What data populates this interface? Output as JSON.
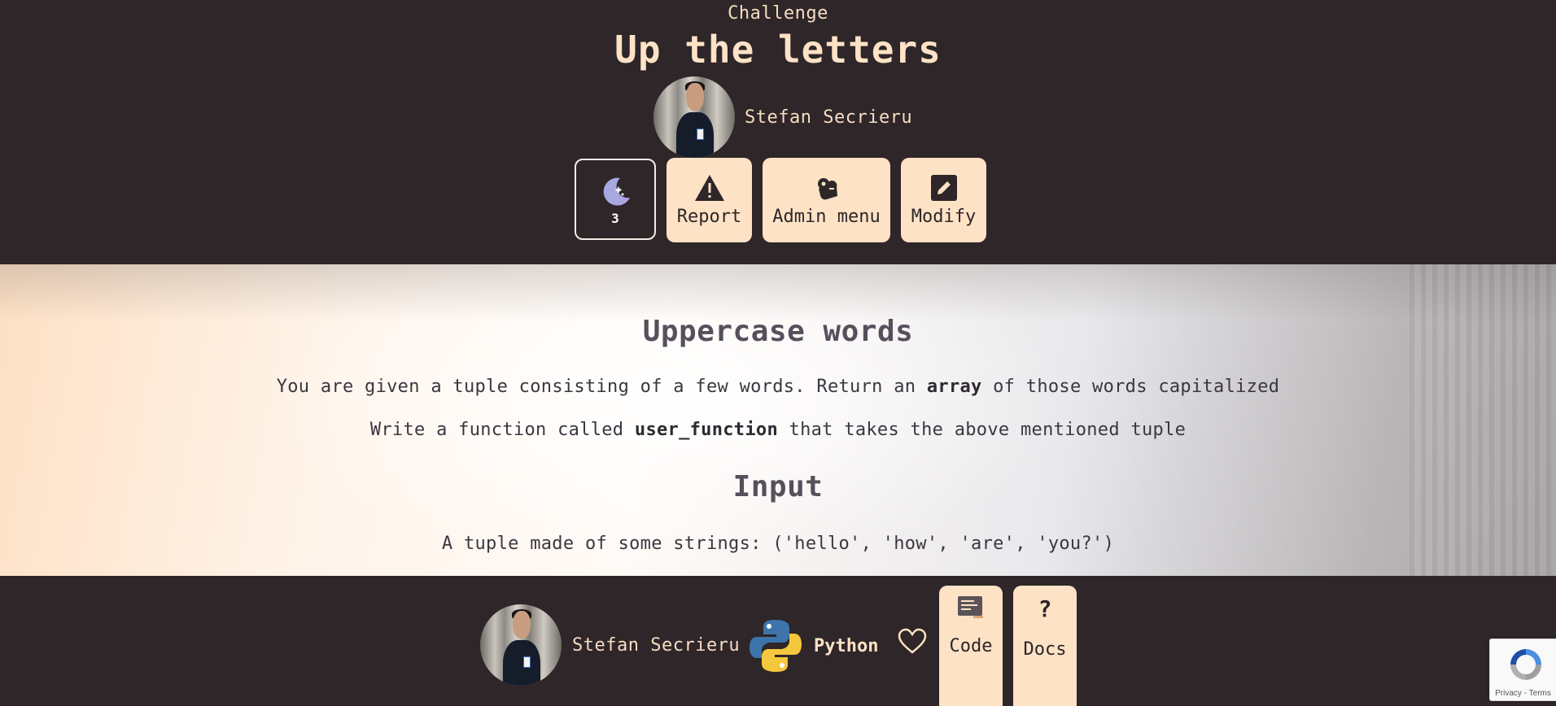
{
  "header": {
    "eyebrow": "Challenge",
    "title": "Up the letters",
    "author": "Stefan Secrieru",
    "moon_count": "3",
    "buttons": {
      "report": "Report",
      "admin": "Admin menu",
      "modify": "Modify"
    }
  },
  "description": {
    "heading": "Uppercase words",
    "line1_before": "You are given a tuple consisting of a few words. Return an ",
    "line1_bold": "array",
    "line1_after": " of those words capitalized",
    "line2_before": "Write a function called ",
    "line2_bold": "user_function",
    "line2_after": " that takes the above mentioned tuple",
    "input_heading": "Input",
    "input_text": "A tuple made of some strings: ('hello', 'how', 'are', 'you?')"
  },
  "footer": {
    "author": "Stefan Secrieru",
    "language": "Python",
    "code_label": "Code",
    "docs_label": "Docs",
    "docs_icon_text": "?"
  },
  "recaptcha": {
    "terms": "Privacy - Terms"
  },
  "colors": {
    "bg_dark": "#2e2628",
    "accent_peach": "#fde2c6",
    "moon_purple": "#a9a7e0"
  }
}
